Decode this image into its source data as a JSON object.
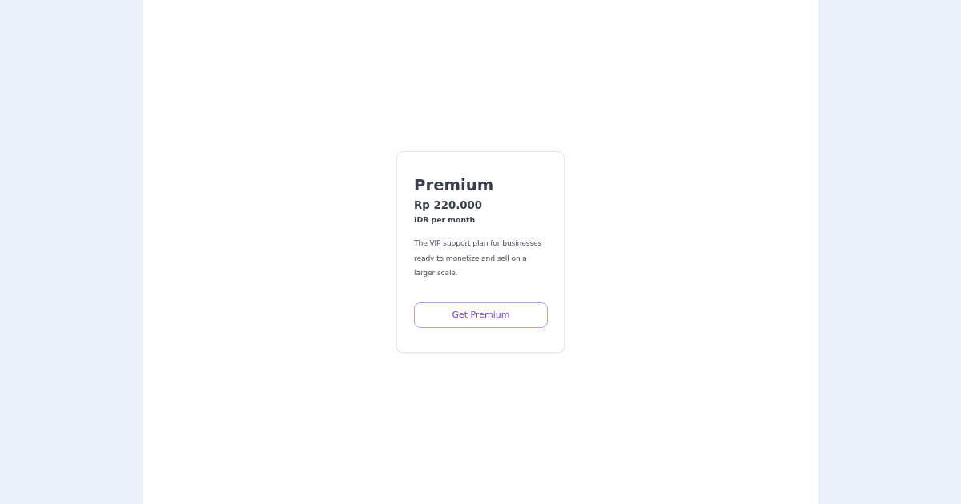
{
  "card": {
    "title": "Premium",
    "price": "Rp 220.000",
    "period": "IDR per month",
    "description": "The VIP support plan for businesses ready to monetize and sell on a larger scale.",
    "button": {
      "label": "Get Premium"
    }
  }
}
